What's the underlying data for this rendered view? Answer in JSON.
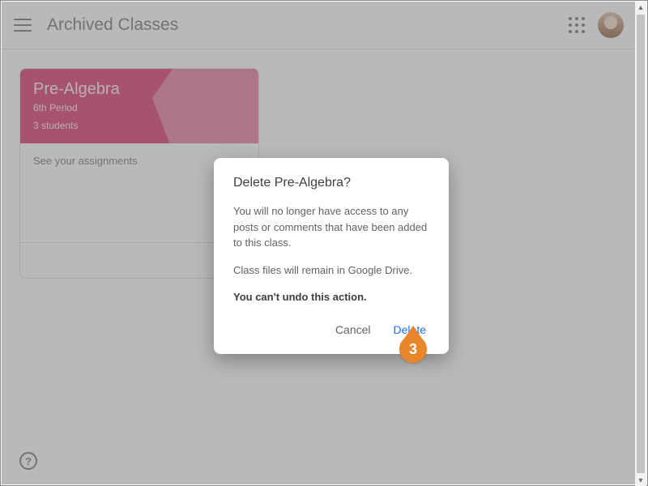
{
  "header": {
    "title": "Archived Classes"
  },
  "card": {
    "title": "Pre-Algebra",
    "period": "6th Period",
    "students": "3 students",
    "body_text": "See your assignments"
  },
  "dialog": {
    "title": "Delete Pre-Algebra?",
    "paragraph1": "You will no longer have access to any posts or comments that have been added to this class.",
    "paragraph2": "Class files will remain in Google Drive.",
    "warning": "You can't undo this action.",
    "cancel_label": "Cancel",
    "delete_label": "Delete"
  },
  "callout": {
    "step": "3"
  },
  "icons": {
    "help": "?"
  }
}
